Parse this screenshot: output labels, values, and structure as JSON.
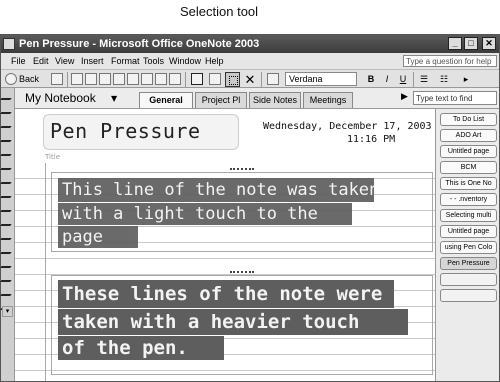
{
  "callout": {
    "label": "Selection tool"
  },
  "window": {
    "title": "Pen Pressure - Microsoft Office OneNote 2003",
    "buttons": {
      "minimize": "_",
      "maximize": "□",
      "close": "✕"
    }
  },
  "menu": {
    "items": [
      "File",
      "Edit",
      "View",
      "Insert",
      "Format",
      "Tools",
      "Window",
      "Help"
    ],
    "help_placeholder": "Type a question for help"
  },
  "toolbar": {
    "back_label": "Back",
    "font": "Verdana",
    "bold": "B",
    "italic": "I",
    "underline": "U"
  },
  "notebook": {
    "title": "My Notebook",
    "sections": [
      {
        "label": "General",
        "active": true
      },
      {
        "label": "Project Pl",
        "active": false
      },
      {
        "label": "Side Notes",
        "active": false
      },
      {
        "label": "Meetings",
        "active": false
      }
    ],
    "find_placeholder": "Type text to find"
  },
  "page": {
    "title": "Pen Pressure",
    "title_hint": "Title",
    "date": "Wednesday, December 17, 2003",
    "time": "11:16 PM",
    "note1": {
      "lines": [
        "This line of the note was taken",
        "with a light touch to the",
        "page"
      ]
    },
    "note2": {
      "lines": [
        "These lines of the note were",
        "taken with a heavier touch",
        "of the pen."
      ]
    }
  },
  "page_tabs": [
    "To Do List",
    "ADO Art",
    "Untitled page",
    "BCM",
    "This is One No",
    "- - .nventory",
    "Selecting multi",
    "Untitled page",
    "using Pen Colo",
    "Pen Pressure",
    "",
    ""
  ],
  "colors": {
    "title_bar": "#474747",
    "ink_highlight": "#5e5e5e",
    "ink_text": "#f3f3f3"
  }
}
